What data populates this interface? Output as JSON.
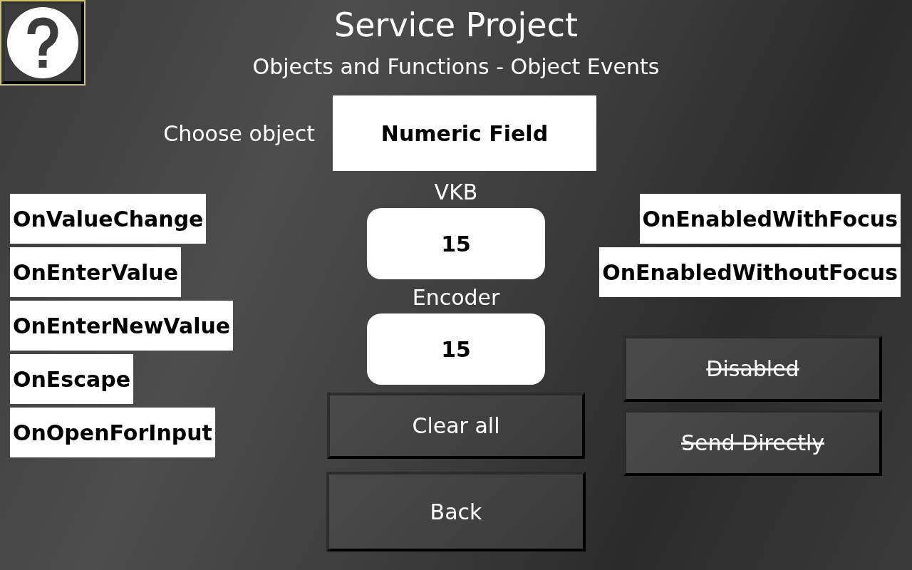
{
  "header": {
    "title": "Service Project",
    "subtitle": "Objects and Functions - Object Events"
  },
  "object_selector": {
    "label": "Choose object",
    "value": "Numeric Field"
  },
  "events": [
    "OnValueChange",
    "OnEnterValue",
    "OnEnterNewValue",
    "OnEscape",
    "OnOpenForInput"
  ],
  "status_events": [
    "OnEnabledWithFocus",
    "OnEnabledWithoutFocus"
  ],
  "inputs": [
    {
      "label": "VKB",
      "value": "15"
    },
    {
      "label": "Encoder",
      "value": "15"
    }
  ],
  "actions": [
    "Clear all",
    "Back"
  ],
  "toggles": [
    {
      "label": "Disabled",
      "on": false
    },
    {
      "label": "Send Directly",
      "on": false
    }
  ]
}
